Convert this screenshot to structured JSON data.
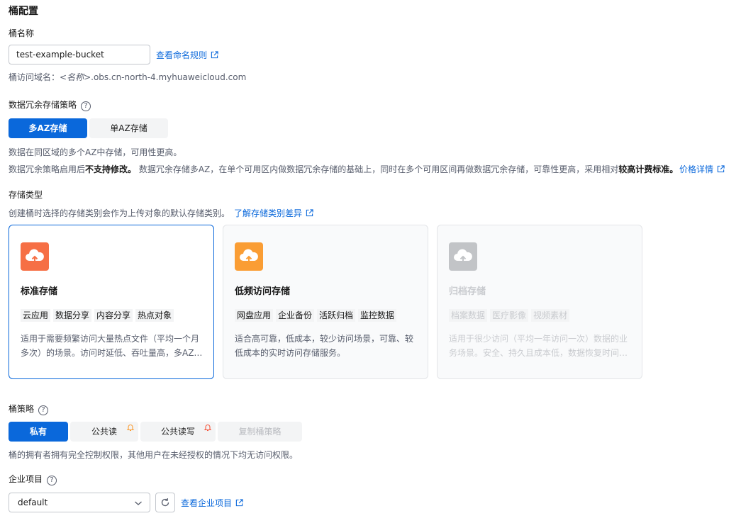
{
  "section_title": "桶配置",
  "bucket_name": {
    "label": "桶名称",
    "value": "test-example-bucket",
    "naming_rules_link": "查看命名规则",
    "domain_prefix": "桶访问域名：<",
    "domain_name_placeholder": "名称",
    "domain_suffix": ">.obs.cn-north-4.myhuaweicloud.com"
  },
  "redundancy": {
    "label": "数据冗余存储策略",
    "options": [
      "多AZ存储",
      "单AZ存储"
    ],
    "selected": "多AZ存储",
    "desc1": "数据在同区域的多个AZ中存储，可用性更高。",
    "desc2_prefix": "数据冗余策略启用后",
    "desc2_bold1": "不支持修改。",
    "desc2_middle": " 数据冗余存储多AZ，在单个可用区内做数据冗余存储的基础上，同时在多个可用区间再做数据冗余存储，可靠性更高，采用相对",
    "desc2_bold2": "较高计费标准。",
    "pricing_link": "价格详情"
  },
  "storage_class": {
    "label": "存储类型",
    "desc": "创建桶时选择的存储类别会作为上传对象的默认存储类别。",
    "diff_link": "了解存储类别差异",
    "cards": [
      {
        "title": "标准存储",
        "icon": "cloud-upload-icon",
        "icon_color": "#f66f45",
        "tags": [
          "云应用",
          "数据分享",
          "内容分享",
          "热点对象"
        ],
        "desc": "适用于需要频繁访问大量热点文件（平均一个月多次）的场景。访问时延低、吞吐量高，多AZ…"
      },
      {
        "title": "低频访问存储",
        "icon": "cloud-upload-icon",
        "icon_color": "#fa9d34",
        "tags": [
          "网盘应用",
          "企业备份",
          "活跃归档",
          "监控数据"
        ],
        "desc": "适合高可靠，低成本，较少访问场景，可靠、较低成本的实时访问存储服务。"
      },
      {
        "title": "归档存储",
        "icon": "cloud-upload-icon",
        "icon_color": "#c2c4c7",
        "tags": [
          "档案数据",
          "医疗影像",
          "视频素材"
        ],
        "desc": "适用于很少访问（平均一年访问一次）数据的业务场景。安全、持久且成本低，数据恢复时间…"
      }
    ]
  },
  "bucket_policy": {
    "label": "桶策略",
    "options": [
      "私有",
      "公共读",
      "公共读写",
      "复制桶策略"
    ],
    "selected": "私有",
    "desc": "桶的拥有者拥有完全控制权限，其他用户在未经授权的情况下均无访问权限。"
  },
  "enterprise_project": {
    "label": "企业项目",
    "value": "default",
    "view_link": "查看企业项目"
  },
  "colors": {
    "primary": "#0a68db",
    "warning_bell": "#fa9d34",
    "danger_bell": "#f6563d"
  }
}
